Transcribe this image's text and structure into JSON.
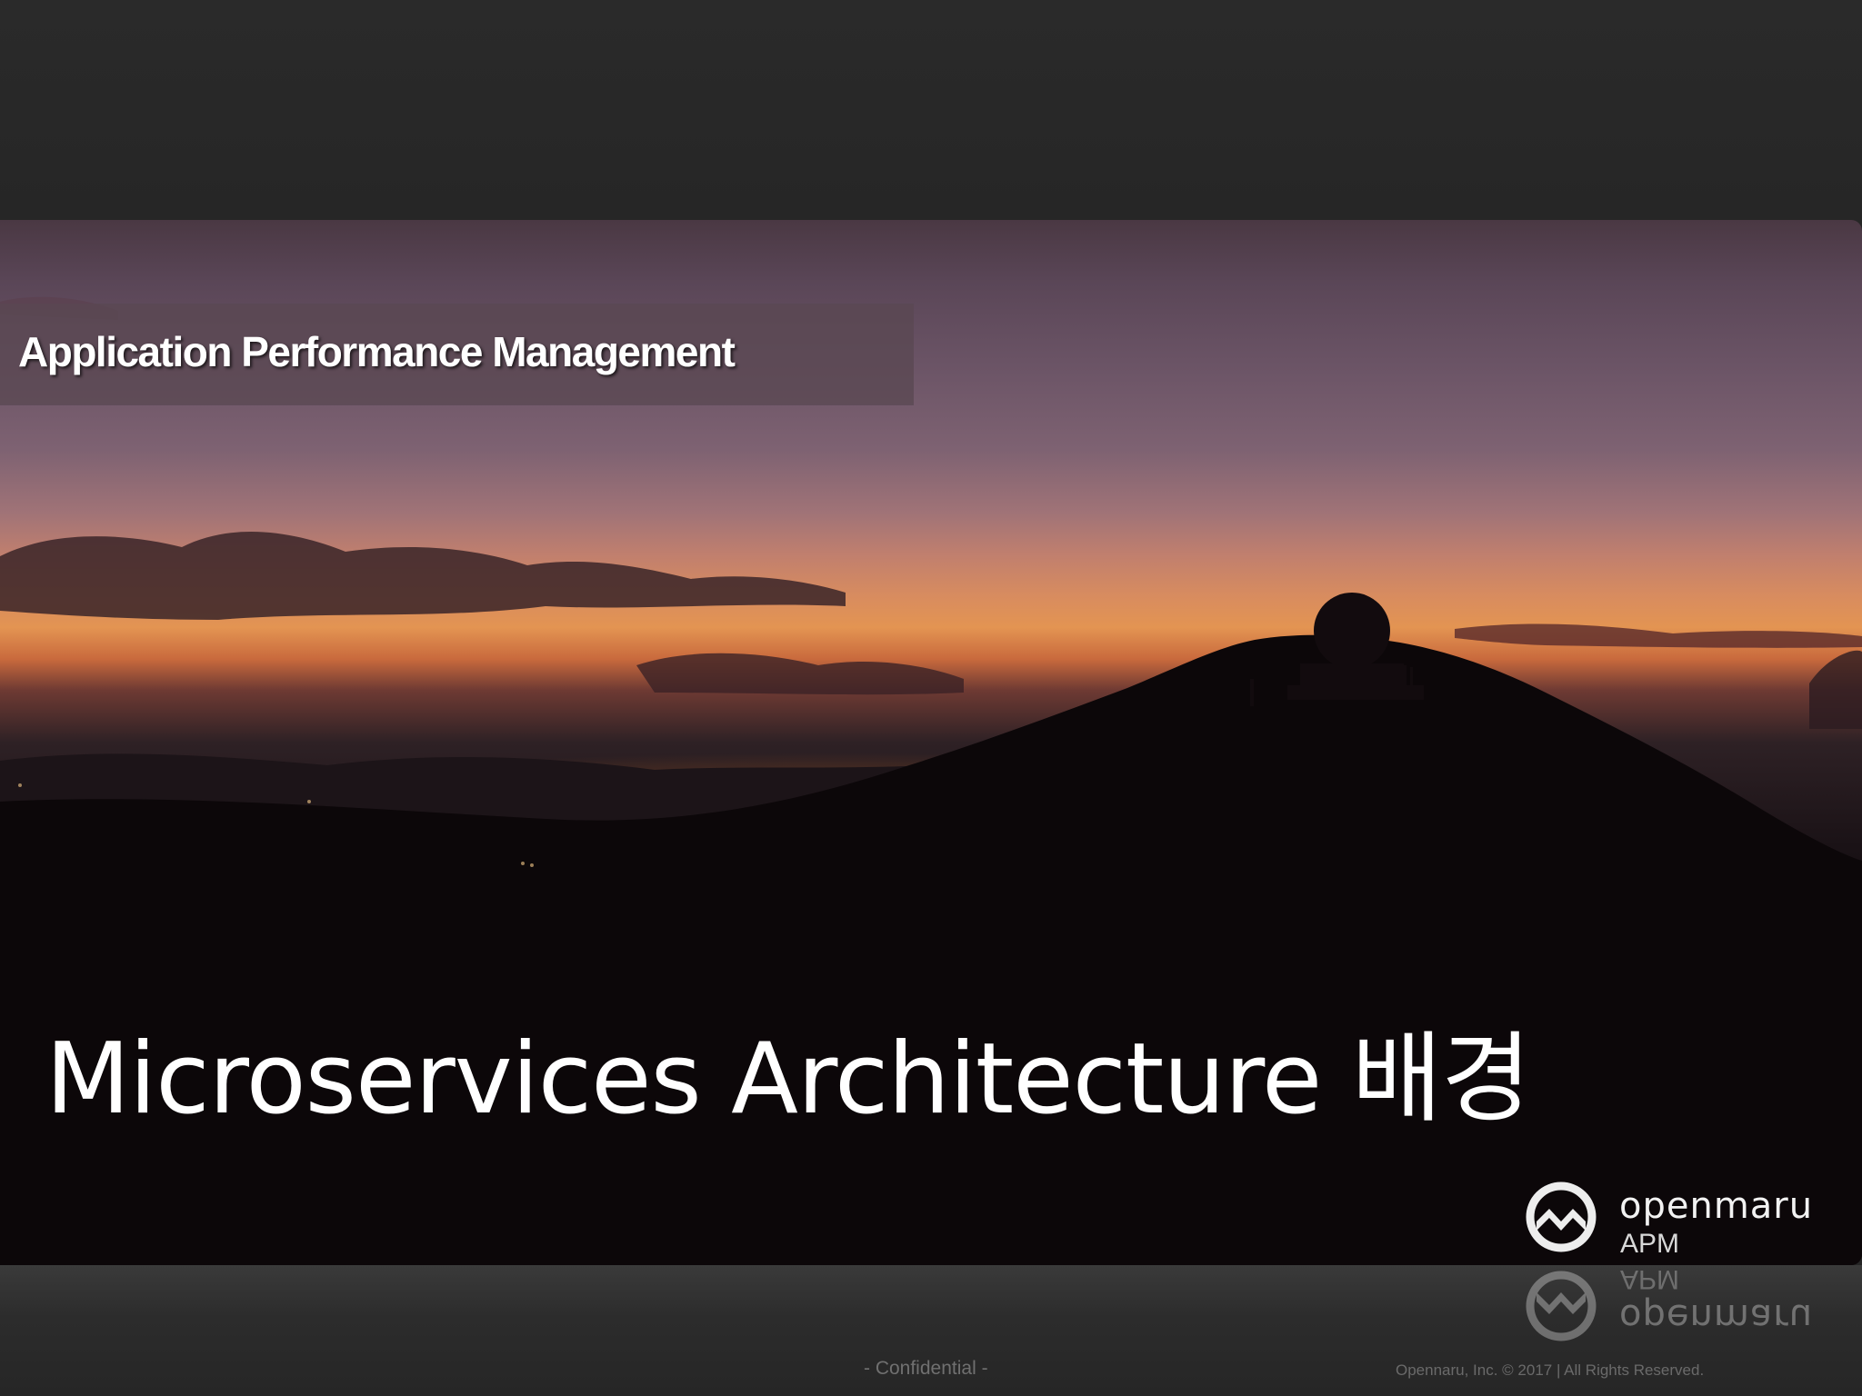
{
  "slide": {
    "subtitle": "Application Performance Management",
    "title": "Microservices Architecture 배경"
  },
  "logo": {
    "name": "openmaru",
    "product": "APM",
    "icon": "openmaru-mountain-logo-icon"
  },
  "footer": {
    "confidential": "- Confidential -",
    "copyright": "Opennaru, Inc. ©  2017 | All Rights Reserved."
  },
  "colors": {
    "sky_top": "#4a3843",
    "sunset_glow": "#e39452",
    "ground": "#0b0709",
    "outer_background": "#262626"
  }
}
